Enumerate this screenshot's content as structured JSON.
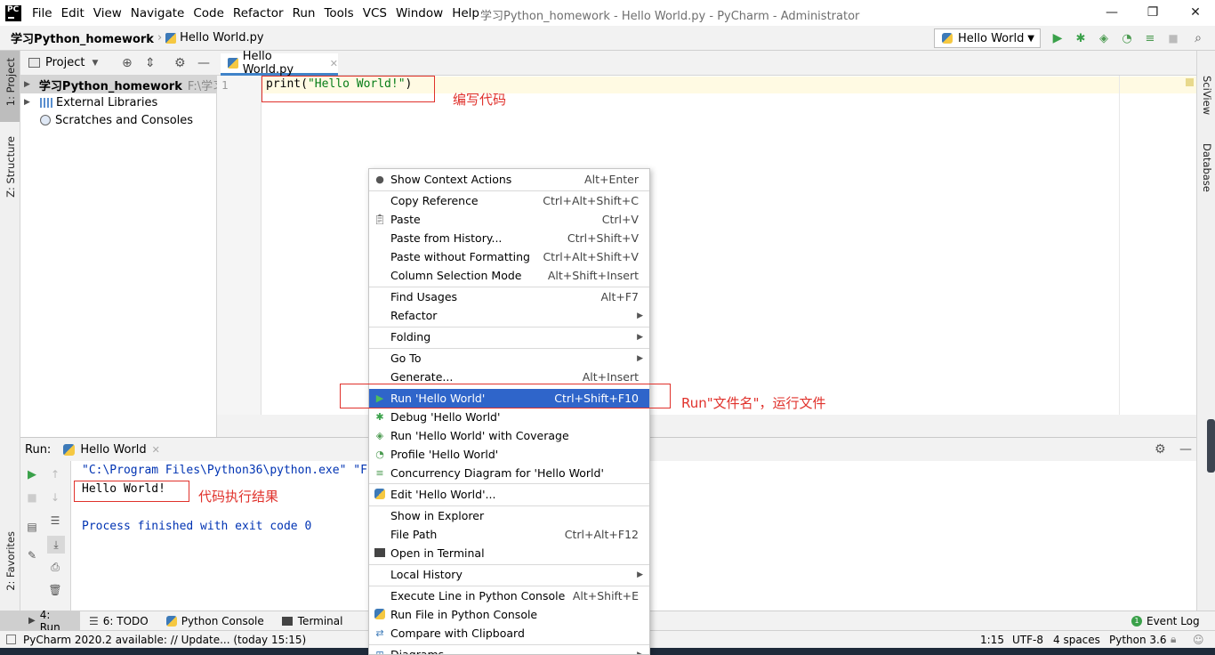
{
  "menubar": {
    "logo_text": "PC",
    "items": [
      "File",
      "Edit",
      "View",
      "Navigate",
      "Code",
      "Refactor",
      "Run",
      "Tools",
      "VCS",
      "Window",
      "Help"
    ],
    "title": "学习Python_homework - Hello World.py - PyCharm - Administrator"
  },
  "navbar": {
    "project": "学习Python_homework",
    "file": "Hello World.py",
    "run_config": "Hello World"
  },
  "left_stripe": {
    "project": "1: Project",
    "structure": "Z: Structure",
    "favorites": "2: Favorites"
  },
  "right_stripe": {
    "sciview": "SciView",
    "database": "Database"
  },
  "project_panel": {
    "title": "Project",
    "items": [
      {
        "label": "学习Python_homework",
        "path": "F:\\学习"
      },
      {
        "label": "External Libraries"
      },
      {
        "label": "Scratches and Consoles"
      }
    ]
  },
  "editor": {
    "tab": "Hello World.py",
    "line_number": "1",
    "code": "print(\"Hello World!\")"
  },
  "annotations": {
    "write_code": "编写代码",
    "run_file": "Run\"文件名\"，运行文件",
    "result": "代码执行结果"
  },
  "run_panel": {
    "label": "Run:",
    "tab": "Hello World",
    "lines": [
      "\"C:\\Program Files\\Python36\\python.exe\" \"F",
      "Hello World!",
      "",
      "Process finished with exit code 0"
    ]
  },
  "context_menu": {
    "items": [
      {
        "label": "Show Context Actions",
        "shortcut": "Alt+Enter",
        "icon": "bulb-icon"
      },
      {
        "label": "Copy Reference",
        "shortcut": "Ctrl+Alt+Shift+C"
      },
      {
        "label": "Paste",
        "shortcut": "Ctrl+V",
        "icon": "clipboard-icon"
      },
      {
        "label": "Paste from History...",
        "shortcut": "Ctrl+Shift+V"
      },
      {
        "label": "Paste without Formatting",
        "shortcut": "Ctrl+Alt+Shift+V"
      },
      {
        "label": "Column Selection Mode",
        "shortcut": "Alt+Shift+Insert"
      },
      {
        "label": "Find Usages",
        "shortcut": "Alt+F7"
      },
      {
        "label": "Refactor",
        "shortcut": ""
      },
      {
        "label": "Folding",
        "shortcut": ""
      },
      {
        "label": "Go To",
        "shortcut": ""
      },
      {
        "label": "Generate...",
        "shortcut": "Alt+Insert"
      },
      {
        "label": "Run 'Hello World'",
        "shortcut": "Ctrl+Shift+F10",
        "icon": "play-icon"
      },
      {
        "label": "Debug 'Hello World'",
        "shortcut": "",
        "icon": "bug-icon"
      },
      {
        "label": "Run 'Hello World' with Coverage",
        "shortcut": "",
        "icon": "coverage-icon"
      },
      {
        "label": "Profile 'Hello World'",
        "shortcut": "",
        "icon": "profile-icon"
      },
      {
        "label": "Concurrency Diagram for 'Hello World'",
        "shortcut": "",
        "icon": "concurrency-icon"
      },
      {
        "label": "Edit 'Hello World'...",
        "shortcut": "",
        "icon": "python-icon"
      },
      {
        "label": "Show in Explorer",
        "shortcut": ""
      },
      {
        "label": "File Path",
        "shortcut": "Ctrl+Alt+F12"
      },
      {
        "label": "Open in Terminal",
        "shortcut": "",
        "icon": "terminal-icon"
      },
      {
        "label": "Local History",
        "shortcut": ""
      },
      {
        "label": "Execute Line in Python Console",
        "shortcut": "Alt+Shift+E"
      },
      {
        "label": "Run File in Python Console",
        "shortcut": "",
        "icon": "python-icon"
      },
      {
        "label": "Compare with Clipboard",
        "shortcut": "",
        "icon": "compare-icon"
      },
      {
        "label": "Diagrams",
        "shortcut": ""
      }
    ]
  },
  "bottom_tabs": {
    "run": "4: Run",
    "todo": "6: TODO",
    "python_console": "Python Console",
    "terminal": "Terminal",
    "event_log": "Event Log",
    "event_count": "1"
  },
  "statusbar": {
    "message": "PyCharm 2020.2 available: // Update... (today 15:15)",
    "position": "1:15",
    "encoding": "UTF-8",
    "indent": "4 spaces",
    "interpreter": "Python 3.6"
  },
  "colors": {
    "accent": "#2f65ca",
    "annotation": "#e0312b",
    "code_string": "#067d17"
  }
}
